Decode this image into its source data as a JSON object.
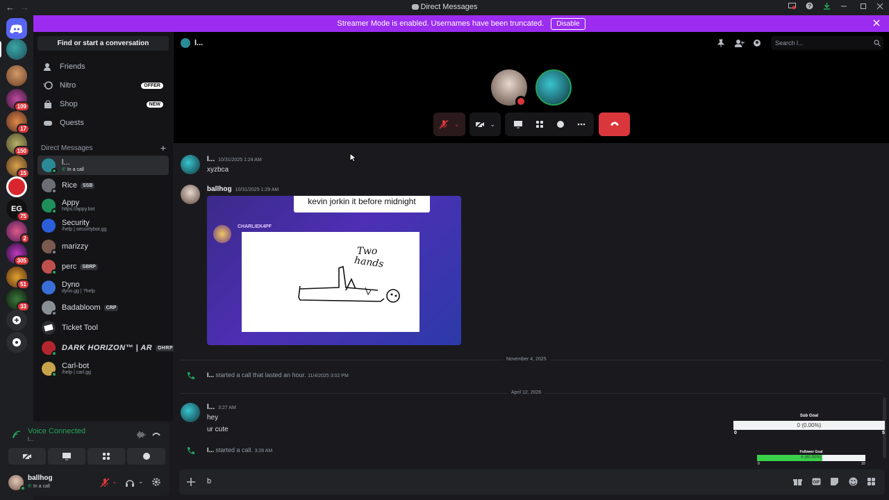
{
  "window": {
    "title": "Direct Messages"
  },
  "banner": {
    "text": "Streamer Mode is enabled. Usernames have been truncated.",
    "button": "Disable"
  },
  "rail": {
    "badges": [
      "109",
      "17",
      "150",
      "15",
      "75",
      "2",
      "305",
      "51",
      "33"
    ]
  },
  "sidebar": {
    "find": "Find or start a conversation",
    "nav": [
      {
        "label": "Friends",
        "icon": "friends-icon"
      },
      {
        "label": "Nitro",
        "icon": "nitro-icon",
        "tag": "OFFER"
      },
      {
        "label": "Shop",
        "icon": "shop-icon",
        "tag": "NEW"
      },
      {
        "label": "Quests",
        "icon": "quests-icon"
      }
    ],
    "dm_header": "Direct Messages",
    "dms": [
      {
        "name": "l...",
        "sub": "In a call",
        "color": "#2a8a96"
      },
      {
        "name": "Rice",
        "chip": "SSB",
        "color": "#6b6f75"
      },
      {
        "name": "Appy",
        "sub": "https://appy.bot",
        "color": "#1f8f5a"
      },
      {
        "name": "Security",
        "sub": "/help | securitybot.gg",
        "color": "#2b5fd9"
      },
      {
        "name": "marizzy",
        "color": "#7a5a4e"
      },
      {
        "name": "perc",
        "chip": "SBRP",
        "color": "#c0504d"
      },
      {
        "name": "Dyno",
        "sub": "dyno.gg | ?help",
        "color": "#3a6fd8"
      },
      {
        "name": "Badabloom",
        "chip": "CRP",
        "color": "#8a8f96"
      },
      {
        "name": "Ticket Tool",
        "color": "#2b2d31"
      },
      {
        "name": "DARK HORIZON™ | AR",
        "chip": "DHRP",
        "color": "#b3262e"
      },
      {
        "name": "Carl-bot",
        "sub": "/help | carl.gg",
        "color": "#c7a34a"
      }
    ]
  },
  "voice": {
    "status": "Voice Connected",
    "channel": "l..."
  },
  "user": {
    "name": "ballhog",
    "status": "In a call"
  },
  "header": {
    "name": "l...",
    "search_placeholder": "Search l..."
  },
  "messages": {
    "m1": {
      "author": "l...",
      "time": "10/31/2025 1:24 AM",
      "text": "xyzbca"
    },
    "m2": {
      "author": "ballhog",
      "time": "10/31/2025 1:29 AM"
    },
    "embed": {
      "caption": "kevin jorkin it before midnight",
      "poster": "CHARLIEK4PF",
      "drawing_text_1": "Two",
      "drawing_text_2": "hands"
    },
    "div1": "November 4, 2025",
    "sys1": {
      "author": "l...",
      "text": "started a call that lasted an hour.",
      "time": "11/4/2025 3:02 PM"
    },
    "div2": "April 12, 2026",
    "m3": {
      "author": "l...",
      "time": "3:27 AM",
      "line1": "hey",
      "line2": "ur cute"
    },
    "sys2": {
      "author": "l...",
      "text": "started a call.",
      "time": "3:28 AM"
    }
  },
  "composer": {
    "value": "b"
  },
  "goals": {
    "sub": {
      "label": "Sub Goal",
      "value": "0 (0.00%)",
      "min": "0",
      "max": "5",
      "fraction": 0.0
    },
    "follower": {
      "label": "Follower Goal",
      "value": "6 (60.00%)",
      "min": "0",
      "max": "10",
      "fraction": 0.6
    }
  },
  "colors": {
    "accent": "#9b2cf0",
    "danger": "#da373c",
    "online": "#23a55a",
    "goal_green": "#3ad14a"
  }
}
